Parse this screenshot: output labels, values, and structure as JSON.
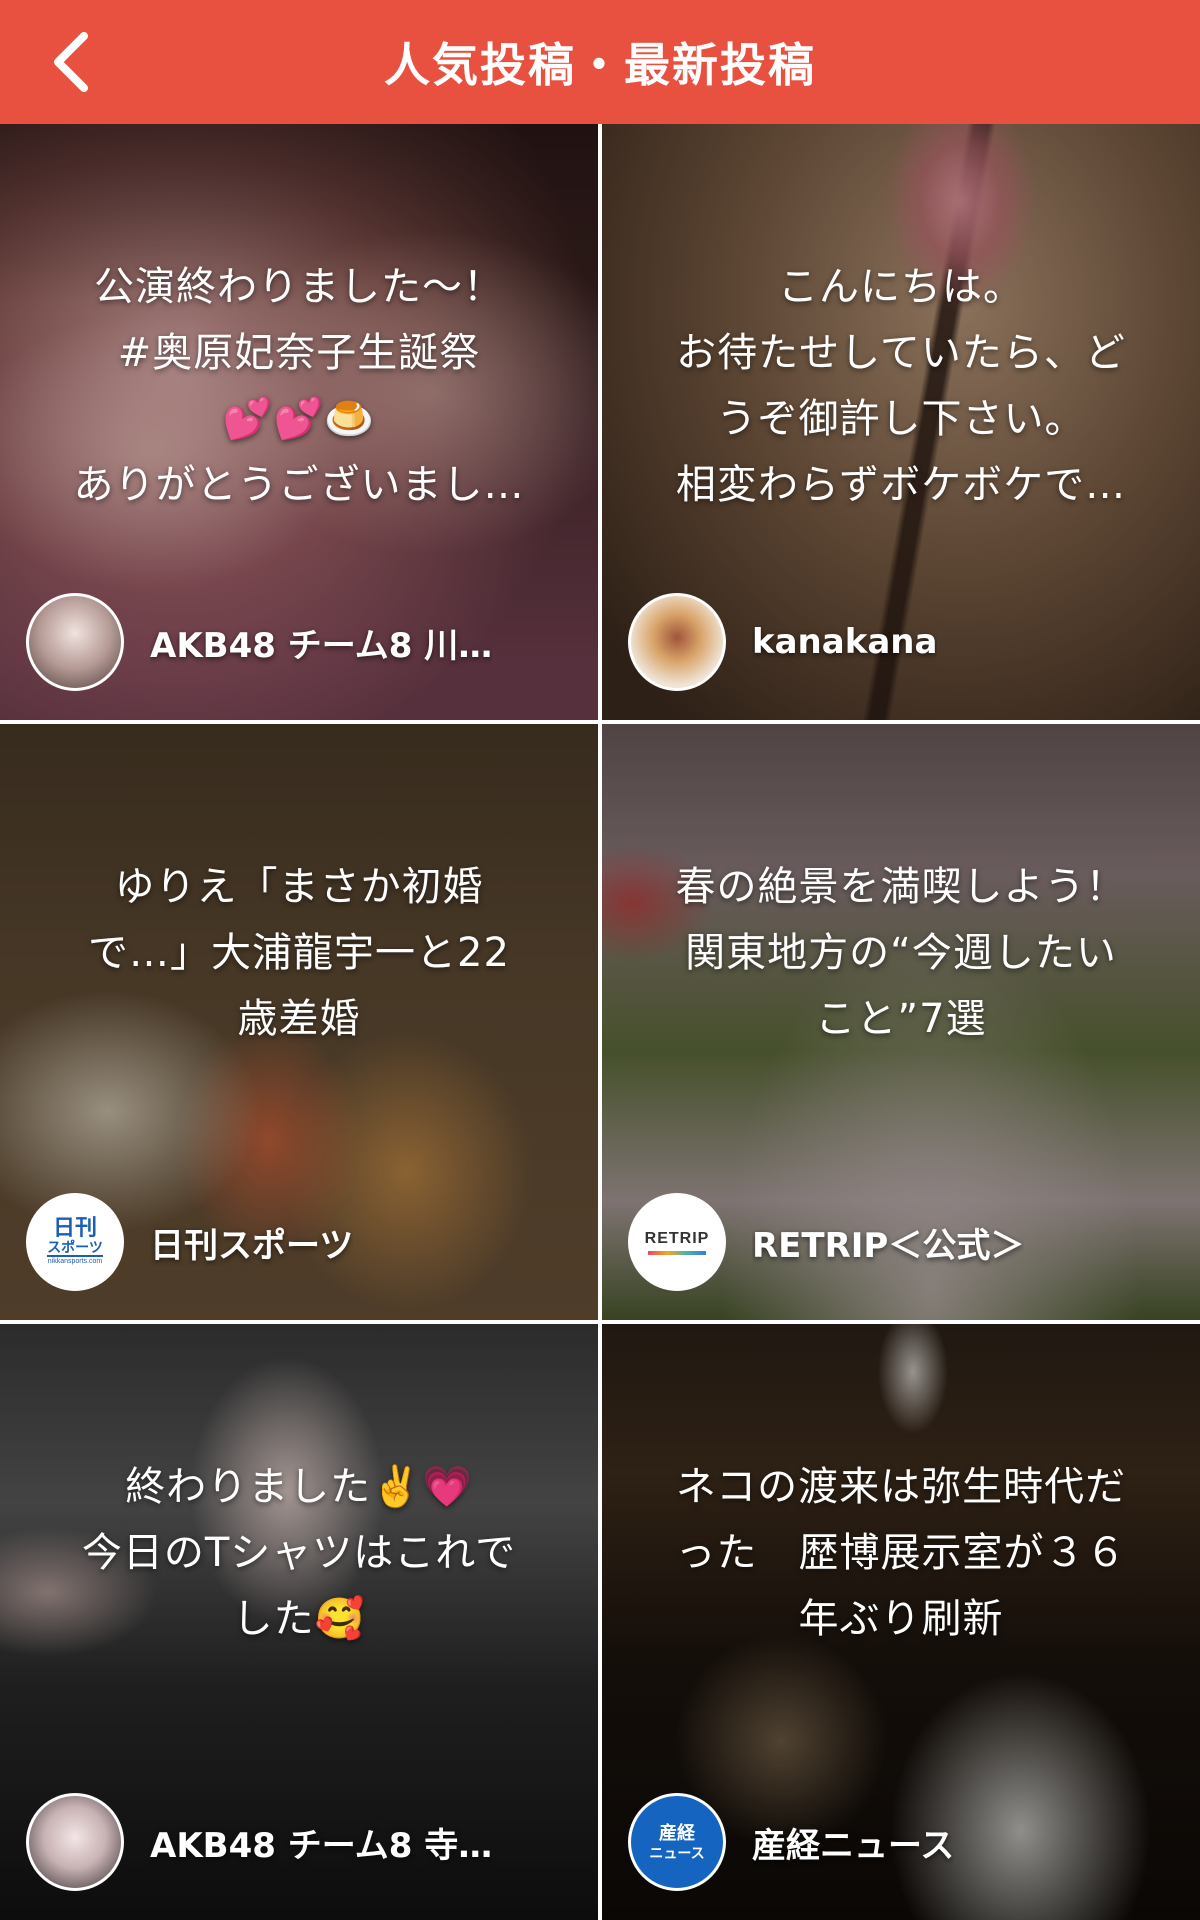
{
  "header": {
    "title": "人気投稿・最新投稿",
    "back_icon": "chevron-left-icon",
    "color": "#e8503f"
  },
  "cards": [
    {
      "caption": "公演終わりました〜！\n#奥原妃奈子生誕祭\n💕💕🍮\nありがとうございまし…",
      "author": "AKB48 チーム8  川…",
      "avatar_icon": "person-photo-icon"
    },
    {
      "caption": "こんにちは。\nお待たせしていたら、ど\nうぞ御許し下さい。\n相変わらずボケボケで…",
      "author": "kanakana",
      "avatar_icon": "dessert-photo-icon"
    },
    {
      "caption": "ゆりえ「まさか初婚\nで…」大浦龍宇一と22\n歳差婚",
      "author": "日刊スポーツ",
      "avatar_logo_line1": "日刊",
      "avatar_logo_line2": "スポーツ",
      "avatar_logo_small": "nikkansports.com"
    },
    {
      "caption": "春の絶景を満喫しよう！\n関東地方の“今週したい\nこと”7選",
      "author": "RETRIP＜公式＞",
      "avatar_logo": "RETRIP"
    },
    {
      "caption": "終わりました✌️💗\n今日のTシャツはこれで\nした🥰",
      "author": "AKB48 チーム8 寺…",
      "avatar_icon": "person-photo-icon"
    },
    {
      "caption": "ネコの渡来は弥生時代だ\nった　歴博展示室が３６\n年ぶり刷新",
      "author": "産経ニュース",
      "avatar_logo_line1": "産経",
      "avatar_logo_line2": "ニュース"
    }
  ]
}
